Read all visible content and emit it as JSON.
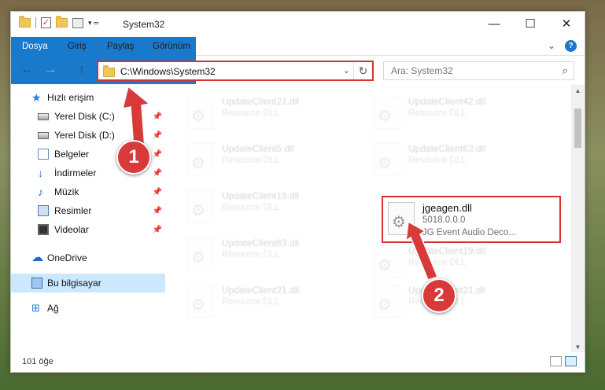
{
  "window": {
    "title": "System32",
    "minimize": "—",
    "maximize": "☐",
    "close": "✕"
  },
  "ribbon": {
    "tabs": [
      "Dosya",
      "Giriş",
      "Paylaş",
      "Görünüm"
    ],
    "expand": "⌄",
    "help": "?"
  },
  "nav": {
    "back": "←",
    "forward": "→",
    "recent": "⌄",
    "up": "↑"
  },
  "address": {
    "path": "C:\\Windows\\System32",
    "dropdown": "⌄",
    "refresh": "↻"
  },
  "search": {
    "placeholder": "Ara: System32",
    "icon": "search-icon"
  },
  "sidebar": {
    "items": [
      {
        "label": "Hızlı erişim",
        "icon": "star-icon"
      },
      {
        "label": "Yerel Disk (C:)",
        "icon": "drive-icon",
        "pinned": true
      },
      {
        "label": "Yerel Disk (D:)",
        "icon": "drive-icon",
        "pinned": true
      },
      {
        "label": "Belgeler",
        "icon": "documents-icon",
        "pinned": true
      },
      {
        "label": "İndirmeler",
        "icon": "download-icon",
        "pinned": true
      },
      {
        "label": "Müzik",
        "icon": "music-icon",
        "pinned": true
      },
      {
        "label": "Resimler",
        "icon": "pictures-icon",
        "pinned": true
      },
      {
        "label": "Videolar",
        "icon": "videos-icon",
        "pinned": true
      },
      {
        "label": "OneDrive",
        "icon": "cloud-icon"
      },
      {
        "label": "Bu bilgisayar",
        "icon": "computer-icon",
        "selected": true
      },
      {
        "label": "Ağ",
        "icon": "network-icon"
      }
    ],
    "pin_glyph": "📌"
  },
  "files": {
    "faded": [
      {
        "name": "UpdateClient21.dll",
        "desc": "Resource DLL"
      },
      {
        "name": "UpdateClient42.dll",
        "desc": "Resource DLL"
      },
      {
        "name": "UpdateClient5.dll",
        "desc": "Resource DLL"
      },
      {
        "name": "UpdateClient63.dll",
        "desc": "Resource DLL"
      },
      {
        "name": "UpdateClient19.dll",
        "desc": "Resource DLL"
      },
      {
        "name": "UpdateClient63.dll",
        "desc": "Resource DLL"
      },
      {
        "name": "UpdateClient19.dll",
        "desc": "Resource DLL"
      },
      {
        "name": "UpdateClient21.dll",
        "desc": "Resource DLL"
      },
      {
        "name": "UpdateClient21.dll",
        "desc": "Resource DLL"
      }
    ],
    "highlighted": {
      "name": "jgeagen.dll",
      "version": "5018.0.0.0",
      "desc": "JG Event Audio Deco..."
    }
  },
  "status": {
    "count": "101 öğe"
  },
  "annotations": {
    "step1": "1",
    "step2": "2",
    "color": "#d83a3a"
  }
}
